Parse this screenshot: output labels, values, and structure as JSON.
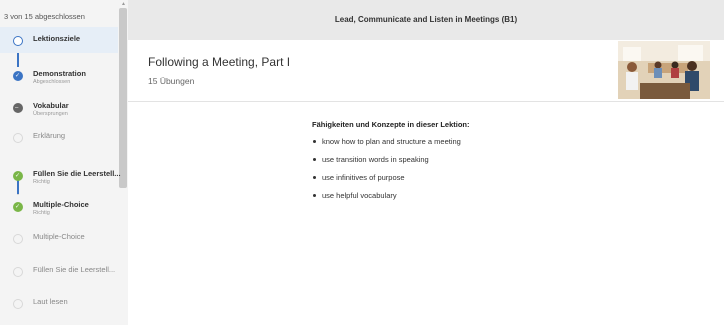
{
  "sidebar": {
    "progress_label": "3 von 15 abgeschlossen",
    "steps": [
      {
        "title": "Lektionsziele",
        "subtitle": "",
        "status": "current"
      },
      {
        "title": "Demonstration",
        "subtitle": "Abgeschlossen",
        "status": "done"
      },
      {
        "title": "Vokabular",
        "subtitle": "Übersprungen",
        "status": "skipped"
      },
      {
        "title": "Erklärung",
        "subtitle": "",
        "status": "open"
      },
      {
        "title": "Füllen Sie die Leerstell...",
        "subtitle": "Richtig",
        "status": "correct"
      },
      {
        "title": "Multiple-Choice",
        "subtitle": "Richtig",
        "status": "correct"
      },
      {
        "title": "Multiple-Choice",
        "subtitle": "",
        "status": "open"
      },
      {
        "title": "Füllen Sie die Leerstell...",
        "subtitle": "",
        "status": "open"
      },
      {
        "title": "Laut lesen",
        "subtitle": "",
        "status": "open"
      }
    ]
  },
  "header": {
    "course_title": "Lead, Communicate and Listen in Meetings (B1)"
  },
  "lesson": {
    "title": "Following a Meeting, Part I",
    "exercise_count": "15 Übungen"
  },
  "content": {
    "skills_heading": "Fähigkeiten und Konzepte in dieser Lektion:",
    "skills": [
      "know how to plan and structure a meeting",
      "use transition words in speaking",
      "use infinitives of purpose",
      "use helpful vocabulary"
    ]
  },
  "colors": {
    "accent": "#3b74c4",
    "correct": "#7ab648",
    "skipped": "#666666"
  }
}
